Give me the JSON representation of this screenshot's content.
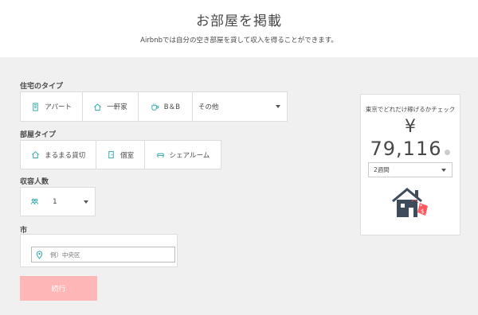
{
  "header": {
    "title": "お部屋を掲載",
    "subtitle": "Airbnbでは自分の空き部屋を貸して収入を得ることができます。"
  },
  "home_type": {
    "label": "住宅のタイプ",
    "options": [
      {
        "label": "アパート",
        "icon": "building-icon"
      },
      {
        "label": "一軒家",
        "icon": "house-icon"
      },
      {
        "label": "B＆B",
        "icon": "coffee-cup-icon"
      }
    ],
    "other_select": "その他"
  },
  "room_type": {
    "label": "部屋タイプ",
    "options": [
      {
        "label": "まるまる貸切",
        "icon": "house-icon"
      },
      {
        "label": "個室",
        "icon": "door-icon"
      },
      {
        "label": "シェアルーム",
        "icon": "couch-icon"
      }
    ]
  },
  "guests": {
    "label": "収容人数",
    "value": "1",
    "icon": "people-icon"
  },
  "city": {
    "label": "市",
    "placeholder": "例）中央区",
    "icon": "map-pin-icon"
  },
  "continue_button": "続行",
  "earnings": {
    "title": "東京でどれだけ稼げるかチェック",
    "currency": "¥",
    "amount": "79,116",
    "period_select": "2週間"
  },
  "colors": {
    "accent": "#ff5a5f",
    "continue_disabled": "#ffb6b6",
    "house_dark": "#3d4b5a",
    "teal": "#2aa5a5"
  }
}
